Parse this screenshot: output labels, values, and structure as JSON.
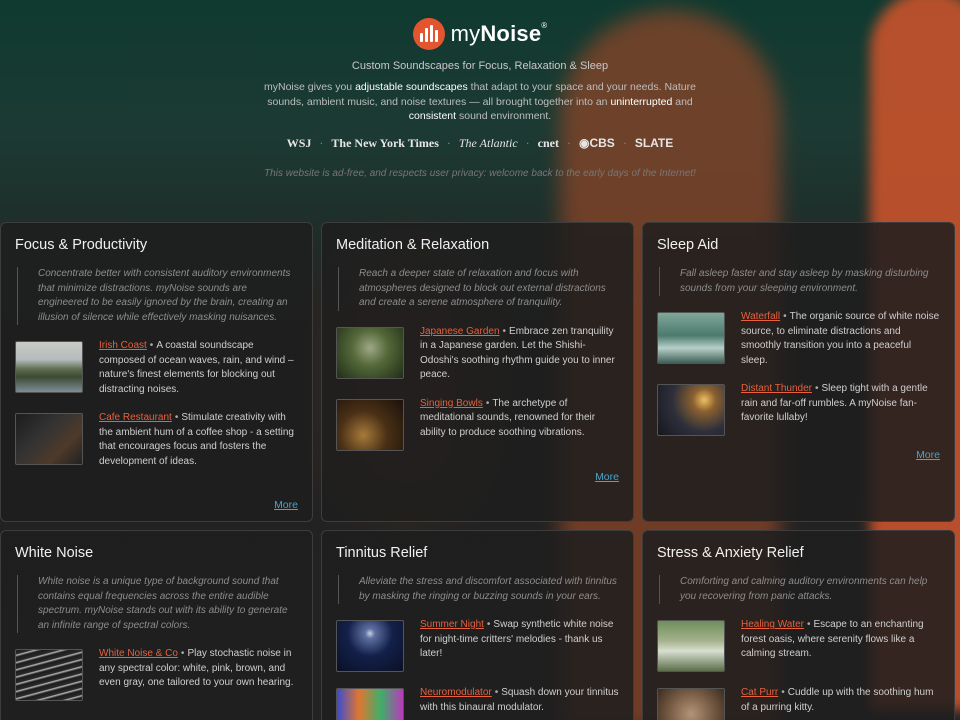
{
  "header": {
    "logo_text_plain": "my",
    "logo_text_bold": "Noise",
    "logo_reg": "®",
    "tagline": "Custom Soundscapes for Focus, Relaxation & Sleep",
    "intro": {
      "p1": "myNoise gives you ",
      "h1": "adjustable soundscapes",
      "p2": " that adapt to your space and your needs. Nature sounds, ambient music, and noise textures — all brought together into an ",
      "h2": "uninterrupted",
      "p3": " and ",
      "h3": "consistent",
      "p4": " sound environment."
    },
    "press": [
      "WSJ",
      "The New York Times",
      "The Atlantic",
      "cnet",
      "CBS",
      "SLATE"
    ],
    "press_separator": "·",
    "privacy": "This website is ad-free, and respects user privacy: welcome back to the early days of the Internet!"
  },
  "item_separator": "•",
  "categories": [
    {
      "title": "Focus & Productivity",
      "description": "Concentrate better with consistent auditory environments that minimize distractions. myNoise sounds are engineered to be easily ignored by the brain, creating an illusion of silence while effectively masking nuisances.",
      "items": [
        {
          "name": "Irish Coast",
          "text": "A coastal soundscape composed of ocean waves, rain, and wind – nature's finest elements for blocking out distracting noises.",
          "thumb": "t-coast"
        },
        {
          "name": "Cafe Restaurant",
          "text": "Stimulate creativity with the ambient hum of a coffee shop - a setting that encourages focus and fosters the development of ideas.",
          "thumb": "t-cafe"
        }
      ],
      "more": "More"
    },
    {
      "title": "Meditation & Relaxation",
      "description": "Reach a deeper state of relaxation and focus with atmospheres designed to block out external distractions and create a serene atmosphere of tranquility.",
      "items": [
        {
          "name": "Japanese Garden",
          "text": "Embrace zen tranquility in a Japanese garden. Let the Shishi-Odoshi's soothing rhythm guide you to inner peace.",
          "thumb": "t-garden"
        },
        {
          "name": "Singing Bowls",
          "text": "The archetype of meditational sounds, renowned for their ability to produce soothing vibrations.",
          "thumb": "t-bowls"
        }
      ],
      "more": "More"
    },
    {
      "title": "Sleep Aid",
      "description": "Fall asleep faster and stay asleep by masking disturbing sounds from your sleeping environment.",
      "items": [
        {
          "name": "Waterfall",
          "text": "The organic source of white noise source, to eliminate distractions and smoothly transition you into a peaceful sleep.",
          "thumb": "t-water"
        },
        {
          "name": "Distant Thunder",
          "text": "Sleep tight with a gentle rain and far-off rumbles. A myNoise fan-favorite lullaby!",
          "thumb": "t-thunder"
        }
      ],
      "more": "More"
    },
    {
      "title": "White Noise",
      "description": "White noise is a unique type of background sound that contains equal frequencies across the entire audible spectrum. myNoise stands out with its ability to generate an infinite range of spectral colors.",
      "items": [
        {
          "name": "White Noise & Co",
          "text": "Play stochastic noise in any spectral color: white, pink, brown, and even gray, one tailored to your own hearing.",
          "thumb": "t-white"
        }
      ]
    },
    {
      "title": "Tinnitus Relief",
      "description": "Alleviate the stress and discomfort associated with tinnitus by masking the ringing or buzzing sounds in your ears.",
      "items": [
        {
          "name": "Summer Night",
          "text": "Swap synthetic white noise for night-time critters' melodies - thank us later!",
          "thumb": "t-night"
        },
        {
          "name": "Neuromodulator",
          "text": "Squash down your tinnitus with this binaural modulator.",
          "thumb": "t-neuro"
        }
      ]
    },
    {
      "title": "Stress & Anxiety Relief",
      "description": "Comforting and calming auditory environments can help you recovering from panic attacks.",
      "items": [
        {
          "name": "Healing Water",
          "text": "Escape to an enchanting forest oasis, where serenity flows like a calming stream.",
          "thumb": "t-heal"
        },
        {
          "name": "Cat Purr",
          "text": "Cuddle up with the soothing hum of a purring kitty.",
          "thumb": "t-cat"
        }
      ]
    }
  ]
}
